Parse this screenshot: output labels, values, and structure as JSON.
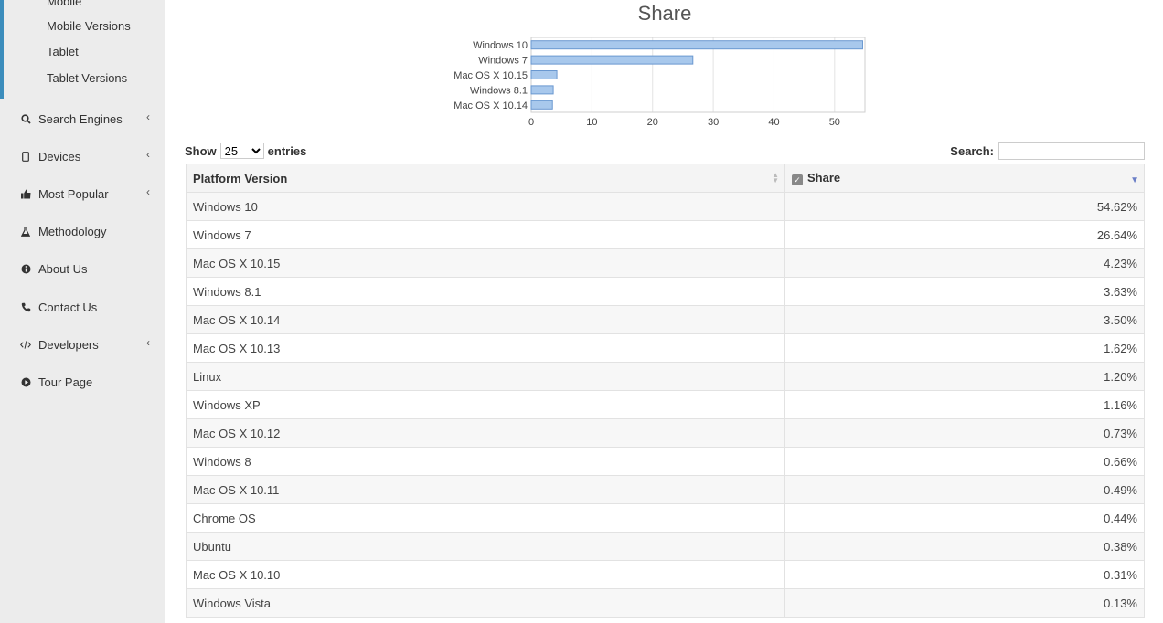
{
  "sidebar": {
    "sub_items": [
      "Mobile",
      "Mobile Versions",
      "Tablet",
      "Tablet Versions"
    ],
    "items": [
      {
        "label": "Search Engines",
        "icon": "search-icon",
        "caret": "‹"
      },
      {
        "label": "Devices",
        "icon": "device-icon",
        "caret": "‹"
      },
      {
        "label": "Most Popular",
        "icon": "thumbs-up-icon",
        "caret": "‹"
      },
      {
        "label": "Methodology",
        "icon": "flask-icon",
        "caret": ""
      },
      {
        "label": "About Us",
        "icon": "info-icon",
        "caret": ""
      },
      {
        "label": "Contact Us",
        "icon": "phone-icon",
        "caret": ""
      },
      {
        "label": "Developers",
        "icon": "code-icon",
        "caret": "‹"
      },
      {
        "label": "Tour Page",
        "icon": "play-circle-icon",
        "caret": ""
      }
    ]
  },
  "chart_data": {
    "type": "bar",
    "title": "Share",
    "categories": [
      "Windows 10",
      "Windows 7",
      "Mac OS X 10.15",
      "Windows 8.1",
      "Mac OS X 10.14"
    ],
    "values": [
      54.62,
      26.64,
      4.23,
      3.63,
      3.5
    ],
    "xlim": [
      0,
      55
    ],
    "xticks": [
      0,
      10,
      20,
      30,
      40,
      50
    ],
    "grid": true,
    "orientation": "horizontal",
    "bar_color": "#a8c8ec",
    "bar_border": "#6a98d0"
  },
  "controls": {
    "show_label": "Show",
    "length_value": "25",
    "entries_label": "entries",
    "search_label": "Search:",
    "search_value": ""
  },
  "table": {
    "headers": [
      "Platform Version",
      "Share"
    ],
    "rows": [
      [
        "Windows 10",
        "54.62%"
      ],
      [
        "Windows 7",
        "26.64%"
      ],
      [
        "Mac OS X 10.15",
        "4.23%"
      ],
      [
        "Windows 8.1",
        "3.63%"
      ],
      [
        "Mac OS X 10.14",
        "3.50%"
      ],
      [
        "Mac OS X 10.13",
        "1.62%"
      ],
      [
        "Linux",
        "1.20%"
      ],
      [
        "Windows XP",
        "1.16%"
      ],
      [
        "Mac OS X 10.12",
        "0.73%"
      ],
      [
        "Windows 8",
        "0.66%"
      ],
      [
        "Mac OS X 10.11",
        "0.49%"
      ],
      [
        "Chrome OS",
        "0.44%"
      ],
      [
        "Ubuntu",
        "0.38%"
      ],
      [
        "Mac OS X 10.10",
        "0.31%"
      ],
      [
        "Windows Vista",
        "0.13%"
      ]
    ]
  },
  "colors": {
    "sidebar_bg": "#ececec",
    "accent": "#3c8dbc",
    "sort_arrow": "#6b7fc7"
  }
}
